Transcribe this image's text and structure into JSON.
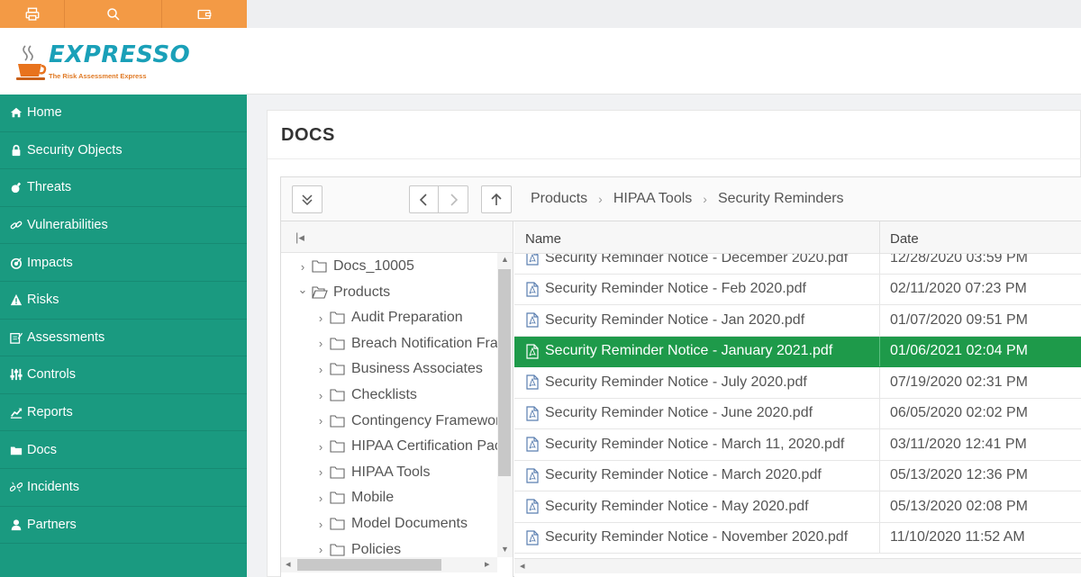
{
  "app": {
    "logo_text": "EXPRESSO",
    "logo_subtitle": "The Risk Assessment Express"
  },
  "topbar": {
    "icons": [
      "printer-icon",
      "search-icon",
      "wallet-icon"
    ]
  },
  "sidebar": {
    "items": [
      {
        "label": "Home",
        "icon": "home-icon"
      },
      {
        "label": "Security Objects",
        "icon": "lock-icon"
      },
      {
        "label": "Threats",
        "icon": "bomb-icon"
      },
      {
        "label": "Vulnerabilities",
        "icon": "link-icon"
      },
      {
        "label": "Impacts",
        "icon": "target-icon"
      },
      {
        "label": "Risks",
        "icon": "warning-icon"
      },
      {
        "label": "Assessments",
        "icon": "edit-icon"
      },
      {
        "label": "Controls",
        "icon": "sliders-icon"
      },
      {
        "label": "Reports",
        "icon": "chart-icon"
      },
      {
        "label": "Docs",
        "icon": "folder-icon"
      },
      {
        "label": "Incidents",
        "icon": "unlink-icon"
      },
      {
        "label": "Partners",
        "icon": "user-icon"
      }
    ],
    "active_color": "#1a9a80"
  },
  "page": {
    "title": "DOCS"
  },
  "breadcrumb": [
    "Products",
    "HIPAA Tools",
    "Security Reminders"
  ],
  "tree": {
    "nodes": [
      {
        "label": "Docs_10005",
        "level": 0,
        "expanded": false
      },
      {
        "label": "Products",
        "level": 0,
        "expanded": true
      },
      {
        "label": "Audit Preparation",
        "level": 1,
        "expanded": false
      },
      {
        "label": "Breach Notification Fra",
        "level": 1,
        "expanded": false
      },
      {
        "label": "Business Associates",
        "level": 1,
        "expanded": false
      },
      {
        "label": "Checklists",
        "level": 1,
        "expanded": false
      },
      {
        "label": "Contingency Framewor",
        "level": 1,
        "expanded": false
      },
      {
        "label": "HIPAA Certification Pac",
        "level": 1,
        "expanded": false
      },
      {
        "label": "HIPAA Tools",
        "level": 1,
        "expanded": false
      },
      {
        "label": "Mobile",
        "level": 1,
        "expanded": false
      },
      {
        "label": "Model Documents",
        "level": 1,
        "expanded": false
      },
      {
        "label": "Policies",
        "level": 1,
        "expanded": false
      }
    ]
  },
  "grid": {
    "columns": {
      "name": "Name",
      "date": "Date"
    },
    "rows": [
      {
        "name": "Security Reminder Notice - December 2020.pdf",
        "date": "12/28/2020 03:59 PM"
      },
      {
        "name": "Security Reminder Notice - Feb 2020.pdf",
        "date": "02/11/2020 07:23 PM"
      },
      {
        "name": "Security Reminder Notice - Jan 2020.pdf",
        "date": "01/07/2020 09:51 PM"
      },
      {
        "name": "Security Reminder Notice - January 2021.pdf",
        "date": "01/06/2021 02:04 PM",
        "selected": true
      },
      {
        "name": "Security Reminder Notice - July 2020.pdf",
        "date": "07/19/2020 02:31 PM"
      },
      {
        "name": "Security Reminder Notice - June 2020.pdf",
        "date": "06/05/2020 02:02 PM"
      },
      {
        "name": "Security Reminder Notice - March 11, 2020.pdf",
        "date": "03/11/2020 12:41 PM"
      },
      {
        "name": "Security Reminder Notice - March 2020.pdf",
        "date": "05/13/2020 12:36 PM"
      },
      {
        "name": "Security Reminder Notice - May 2020.pdf",
        "date": "05/13/2020 02:08 PM"
      },
      {
        "name": "Security Reminder Notice - November 2020.pdf",
        "date": "11/10/2020 11:52 AM"
      }
    ],
    "selected_color": "#1e9a4a"
  },
  "colors": {
    "topbar": "#f39a45",
    "sidebar": "#1a9a80",
    "logo": "#1aa0b8"
  }
}
